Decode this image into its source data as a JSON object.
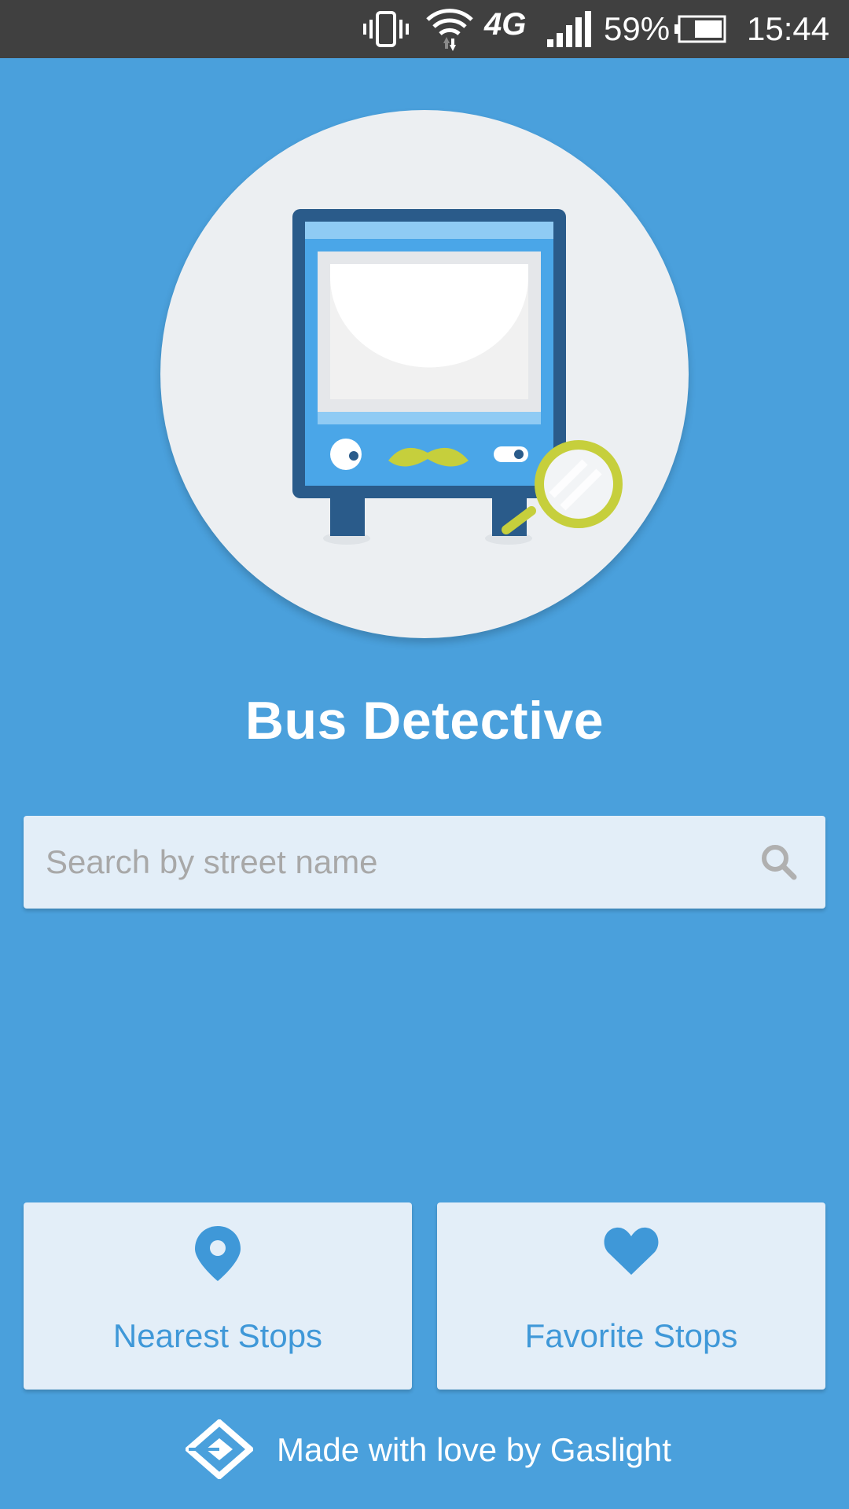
{
  "status_bar": {
    "network": "4G",
    "battery_percent": "59%",
    "time": "15:44",
    "icons": [
      "vibrate-icon",
      "wifi-icon",
      "network-4g-icon",
      "signal-icon",
      "battery-icon"
    ]
  },
  "hero": {
    "illustration": "bus-detective-illustration"
  },
  "app": {
    "title": "Bus Detective"
  },
  "search": {
    "placeholder": "Search by street name",
    "value": "",
    "icon": "search-icon"
  },
  "tiles": [
    {
      "label": "Nearest Stops",
      "icon": "location-pin-icon"
    },
    {
      "label": "Favorite Stops",
      "icon": "heart-icon"
    }
  ],
  "footer": {
    "text": "Made with love by Gaslight",
    "logo": "gaslight-logo"
  },
  "colors": {
    "background": "#4aa0dc",
    "status_bar": "#404040",
    "card": "#e3eef8",
    "accent": "#3f98d8",
    "lime": "#c6cf3c",
    "bus_dark": "#2a5b8a"
  }
}
